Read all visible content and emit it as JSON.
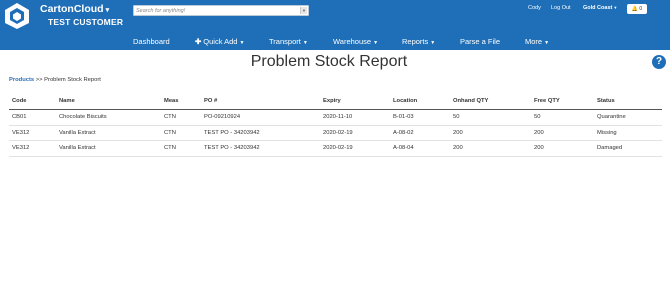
{
  "header": {
    "brand": "CartonCloud",
    "customer": "TEST CUSTOMER",
    "search_placeholder": "Search for anything!",
    "user": "Cody",
    "logout": "Log Out",
    "region": "Gold Coast",
    "notifications": "0"
  },
  "nav": {
    "items": [
      "Dashboard",
      "Quick Add",
      "Transport",
      "Warehouse",
      "Reports",
      "Parse a File",
      "More"
    ]
  },
  "page": {
    "title": "Problem Stock Report",
    "breadcrumb_link": "Products",
    "breadcrumb_sep": ">>",
    "breadcrumb_current": "Problem Stock Report",
    "help": "?"
  },
  "table": {
    "headers": [
      "Code",
      "Name",
      "Meas",
      "PO #",
      "Expiry",
      "Location",
      "Onhand QTY",
      "Free QTY",
      "Status"
    ],
    "rows": [
      [
        "CB01",
        "Chocolate Biscuits",
        "CTN",
        "PO-09210924",
        "2020-11-10",
        "B-01-03",
        "50",
        "50",
        "Quarantine"
      ],
      [
        "VE312",
        "Vanilla Extract",
        "CTN",
        "TEST PO - 34203942",
        "2020-02-19",
        "A-08-02",
        "200",
        "200",
        "Missing"
      ],
      [
        "VE312",
        "Vanilla Extract",
        "CTN",
        "TEST PO - 34203942",
        "2020-02-19",
        "A-08-04",
        "200",
        "200",
        "Damaged"
      ]
    ]
  },
  "colors": {
    "brand_blue": "#1f6fb8",
    "link": "#2a6db3"
  },
  "icons": [
    "logo-cube-icon",
    "caret-down-icon",
    "plus-icon",
    "bell-icon",
    "help-icon"
  ]
}
